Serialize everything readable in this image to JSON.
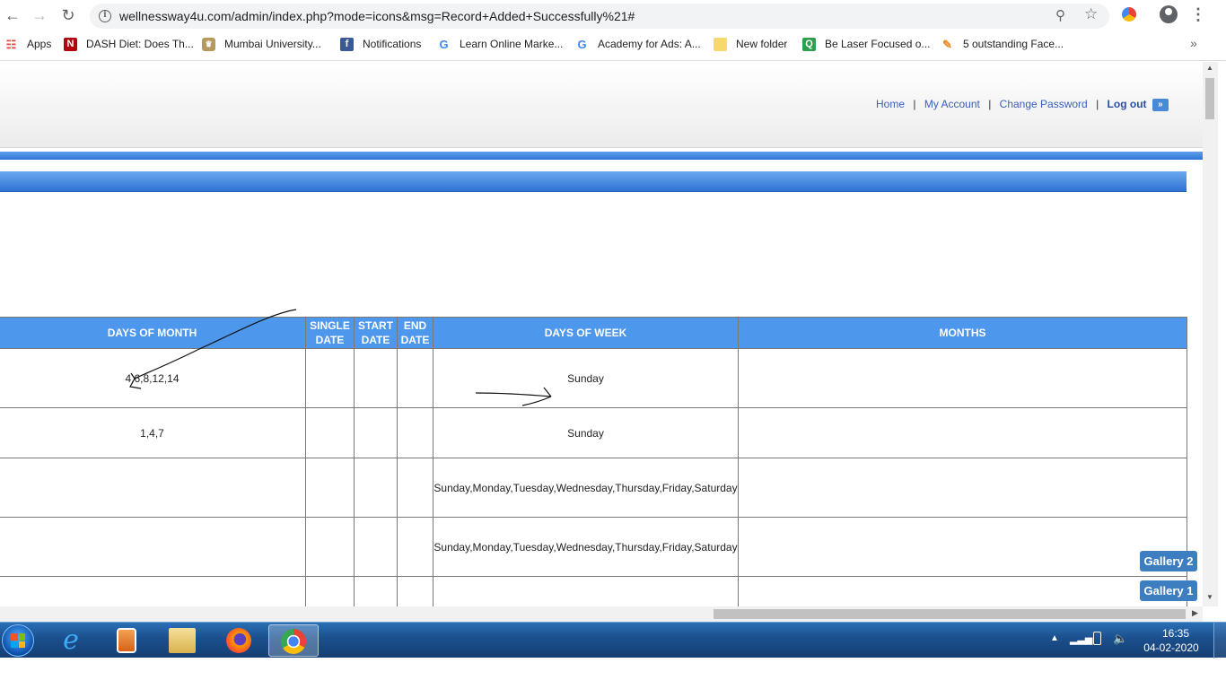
{
  "browser": {
    "url": "wellnessway4u.com/admin/index.php?mode=icons&msg=Record+Added+Successfully%21#",
    "bookmarks": [
      {
        "label": "Apps",
        "icon": "apps-grid-icon",
        "color": "#e8453c"
      },
      {
        "label": "DASH Diet: Does Th...",
        "icon": "netflix-n-icon",
        "color": "#b1060f"
      },
      {
        "label": "Mumbai University...",
        "icon": "university-crest-icon",
        "color": "#8a6d3b"
      },
      {
        "label": "Notifications",
        "icon": "facebook-icon",
        "color": "#3b5998"
      },
      {
        "label": "Learn Online Marke...",
        "icon": "google-g-icon",
        "color": "#4285f4"
      },
      {
        "label": "Academy for Ads: A...",
        "icon": "google-g-icon",
        "color": "#4285f4"
      },
      {
        "label": "New folder",
        "icon": "folder-icon",
        "color": "#f4d35e"
      },
      {
        "label": "Be Laser Focused o...",
        "icon": "q-icon",
        "color": "#2e9e4f"
      },
      {
        "label": "5 outstanding Face...",
        "icon": "pen-icon",
        "color": "#f08a24"
      }
    ]
  },
  "header": {
    "links": {
      "home": "Home",
      "my_account": "My Account",
      "change_password": "Change Password",
      "logout": "Log out"
    },
    "separator": "|"
  },
  "table": {
    "headers": {
      "days_of_month": "DAYS OF MONTH",
      "single_date": "SINGLE DATE",
      "start_date": "START DATE",
      "end_date": "END DATE",
      "days_of_week": "DAYS OF WEEK",
      "months": "MONTHS"
    },
    "rows": [
      {
        "days_of_month": "4,6,8,12,14",
        "single_date": "",
        "start_date": "",
        "end_date": "",
        "days_of_week": "Sunday",
        "months": ""
      },
      {
        "days_of_month": "1,4,7",
        "single_date": "",
        "start_date": "",
        "end_date": "",
        "days_of_week": "Sunday",
        "months": ""
      },
      {
        "days_of_month": "",
        "single_date": "",
        "start_date": "",
        "end_date": "",
        "days_of_week": "Sunday,Monday,Tuesday,Wednesday,Thursday,Friday,Saturday",
        "months": ""
      },
      {
        "days_of_month": "",
        "single_date": "",
        "start_date": "",
        "end_date": "",
        "days_of_week": "Sunday,Monday,Tuesday,Wednesday,Thursday,Friday,Saturday",
        "months": ""
      },
      {
        "days_of_month": "",
        "single_date": "",
        "start_date": "",
        "end_date": "",
        "days_of_week": "",
        "months": ""
      }
    ]
  },
  "gallery": {
    "gallery_2": "Gallery 2",
    "gallery_1": "Gallery 1"
  },
  "taskbar": {
    "apps": [
      "internet-explorer-icon",
      "media-player-icon",
      "file-explorer-icon",
      "firefox-icon",
      "chrome-icon"
    ],
    "time": "16:35",
    "date": "04-02-2020"
  },
  "colors": {
    "table_header": "#4d97ec",
    "link": "#3a5fb8",
    "gallery_button": "#3c7ec0"
  }
}
